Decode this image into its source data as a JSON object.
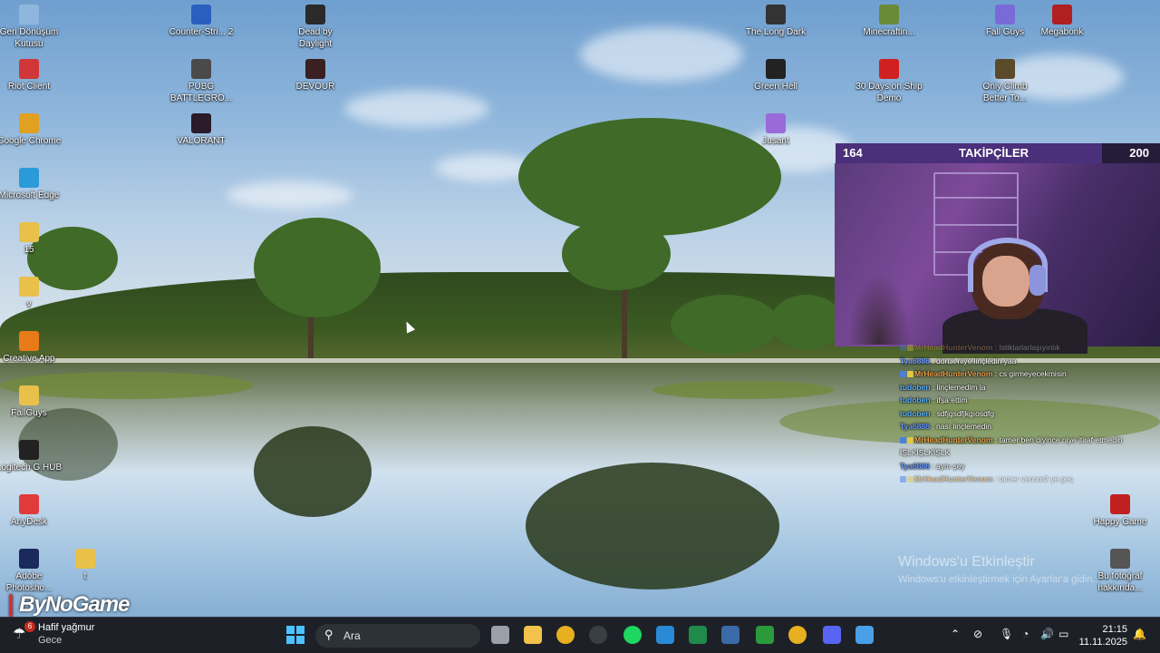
{
  "desktop_icons": [
    {
      "label": "Geri Dönüşüm Kutusu",
      "icon": "recycle-bin-icon",
      "color": "#8fb6dc"
    },
    {
      "label": "Counter-Stri... 2",
      "icon": "counter-strike-icon",
      "color": "#2b5fbf"
    },
    {
      "label": "Dead by Daylight",
      "icon": "dead-by-daylight-icon",
      "color": "#2a2a2a"
    },
    {
      "label": "The Long Dark",
      "icon": "the-long-dark-icon",
      "color": "#333333"
    },
    {
      "label": "Minecraftin...",
      "icon": "minecraft-icon",
      "color": "#6a8a3a"
    },
    {
      "label": "Fall Guys",
      "icon": "fall-guys-icon",
      "color": "#7a6ad8"
    },
    {
      "label": "Megabonk",
      "icon": "megabonk-icon",
      "color": "#b02020"
    },
    {
      "label": "Riot Client",
      "icon": "riot-client-icon",
      "color": "#d13639"
    },
    {
      "label": "PUBG BATTLEGRO...",
      "icon": "pubg-icon",
      "color": "#4a4a4a"
    },
    {
      "label": "DEVOUR",
      "icon": "devour-icon",
      "color": "#3a2020"
    },
    {
      "label": "Green Hell",
      "icon": "green-hell-icon",
      "color": "#222222"
    },
    {
      "label": "30 Days on Ship Demo",
      "icon": "30-days-on-ship-icon",
      "color": "#d02020"
    },
    {
      "label": "Only Climb Better To...",
      "icon": "only-climb-icon",
      "color": "#5a4a2a"
    },
    {
      "label": "Google Chrome",
      "icon": "chrome-icon",
      "color": "#e0a020"
    },
    {
      "label": "VALORANT",
      "icon": "valorant-icon",
      "color": "#2a1a2a"
    },
    {
      "label": "Jusant",
      "icon": "jusant-icon",
      "color": "#9a6ad8"
    },
    {
      "label": "Microsoft Edge",
      "icon": "edge-icon",
      "color": "#2a9ad8"
    },
    {
      "label": "15",
      "icon": "folder-icon",
      "color": "#e8c04a"
    },
    {
      "label": "v",
      "icon": "folder-icon",
      "color": "#e8c04a"
    },
    {
      "label": "Creative App",
      "icon": "creative-app-icon",
      "color": "#e87a1a"
    },
    {
      "label": "FallGuys",
      "icon": "folder-icon",
      "color": "#e8c04a"
    },
    {
      "label": "Logitech G HUB",
      "icon": "logitech-ghub-icon",
      "color": "#222222"
    },
    {
      "label": "AnyDesk",
      "icon": "anydesk-icon",
      "color": "#e03a3a"
    },
    {
      "label": "Adobe Photosho...",
      "icon": "photoshop-icon",
      "color": "#1a2a5a"
    },
    {
      "label": "t",
      "icon": "folder-icon",
      "color": "#e8c04a"
    },
    {
      "label": "Happy Game",
      "icon": "happy-game-icon",
      "color": "#c02020"
    },
    {
      "label": "Bu fotoğraf hakkında...",
      "icon": "camera-icon",
      "color": "#555555"
    }
  ],
  "follower_goal": {
    "current": "164",
    "title": "TAKİPÇİLER",
    "target": "200",
    "progress": 0.82
  },
  "chat": [
    {
      "user": "MrHeadHunterVenom",
      "color": "#e8a04a",
      "msg": "Istiklarlarlaşıyınlık",
      "badges": true
    },
    {
      "user": "Tya6886",
      "color": "#6a9aff",
      "msg": "doruk niye linçledin yaa",
      "badges": false
    },
    {
      "user": "MrHeadHunterVenom",
      "color": "#e8a04a",
      "msg": "cs girmeyecekmisin",
      "badges": true
    },
    {
      "user": "tudoben",
      "color": "#5ab0ff",
      "msg": "linçlemedim la",
      "badges": false
    },
    {
      "user": "tudoben",
      "color": "#5ab0ff",
      "msg": "ifşa ettim",
      "badges": false
    },
    {
      "user": "tudoben",
      "color": "#5ab0ff",
      "msg": "sdfjgsdfjkgıosdfg",
      "badges": false
    },
    {
      "user": "Tya6886",
      "color": "#6a9aff",
      "msg": "nası linçlemedin",
      "badges": false
    },
    {
      "user": "MrHeadHunterVenom",
      "color": "#e8a04a",
      "msg": "tamer ben diyince niye itiraf etmedin İŞLKİŞLKİŞLK",
      "badges": true
    },
    {
      "user": "Tya6886",
      "color": "#6a9aff",
      "msg": "aynı şey",
      "badges": false
    },
    {
      "user": "MrHeadHunterVenom",
      "color": "#e8a04a",
      "msg": "tamer venom2 ye geç",
      "badges": true
    }
  ],
  "activation": {
    "title": "Windows'u Etkinleştir",
    "subtitle": "Windows'u etkinleştirmek için Ayarlar'a gidin."
  },
  "watermark": {
    "text": "ByNoGame"
  },
  "taskbar": {
    "weather": {
      "badge": "6",
      "title": "Hafif yağmur",
      "subtitle": "Gece"
    },
    "search_label": "Ara",
    "apps": [
      {
        "name": "task-view-icon",
        "color": "#9aa0a8"
      },
      {
        "name": "file-explorer-icon",
        "color": "#f2c24a"
      },
      {
        "name": "chrome-icon",
        "color": "#e8b020"
      },
      {
        "name": "obs-icon",
        "color": "#3a3f46"
      },
      {
        "name": "spotify-icon",
        "color": "#1ed760"
      },
      {
        "name": "microsoft-store-icon",
        "color": "#2a8ad8"
      },
      {
        "name": "excel-icon",
        "color": "#1f8a4a"
      },
      {
        "name": "steam-icon",
        "color": "#3a6aa8"
      },
      {
        "name": "xbox-icon",
        "color": "#2a9a3a"
      },
      {
        "name": "chrome-profile-icon",
        "color": "#e8b020"
      },
      {
        "name": "discord-icon",
        "color": "#5865f2"
      },
      {
        "name": "app-icon",
        "color": "#4aa0e8"
      }
    ],
    "clock": {
      "time": "21:15",
      "date": "11.11.2025"
    }
  }
}
